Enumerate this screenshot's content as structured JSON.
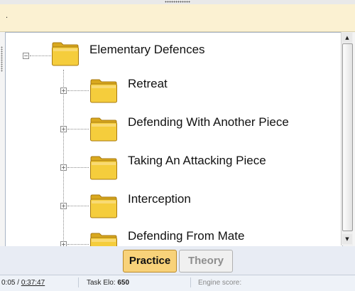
{
  "banner": {
    "text": "."
  },
  "tree": {
    "root": {
      "label": "Elementary Defences",
      "expander": "−",
      "expanded": true
    },
    "children": [
      {
        "label": "Retreat",
        "expander": "+"
      },
      {
        "label": "Defending With Another Piece",
        "expander": "+"
      },
      {
        "label": "Taking An Attacking Piece",
        "expander": "+"
      },
      {
        "label": "Interception",
        "expander": "+"
      },
      {
        "label": "Defending From Mate",
        "expander": "+"
      }
    ]
  },
  "scrollbar": {
    "up_glyph": "▲",
    "down_glyph": "▼"
  },
  "buttons": {
    "practice": "Practice",
    "theory": "Theory",
    "active": "practice"
  },
  "status": {
    "elapsed": "0:05 / ",
    "total": "0:37:47",
    "task_elo_label": "Task Elo: ",
    "task_elo_value": "650",
    "engine_score_label": "Engine score:"
  },
  "colors": {
    "banner": "#fbf1d2",
    "practice_active": "#f8d27a",
    "theory_inactive": "#f0f0f0",
    "folder": "#f5cd3c"
  },
  "icons": {
    "folder": "folder-icon",
    "expand": "plus-box-icon",
    "collapse": "minus-box-icon"
  }
}
